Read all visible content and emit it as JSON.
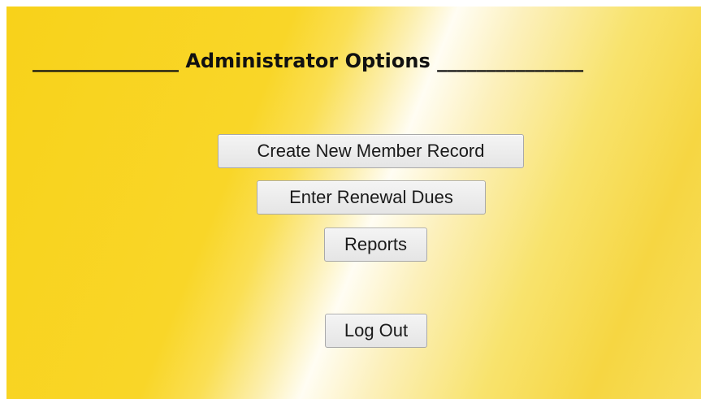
{
  "page": {
    "heading": "_______________ Administrator Options _______________"
  },
  "actions": {
    "create_new_member_record": "Create New Member Record",
    "enter_renewal_dues": "Enter Renewal Dues",
    "reports": "Reports",
    "log_out": "Log Out"
  },
  "colors": {
    "background_gold": "#f8d21a",
    "background_highlight": "#fffdf3",
    "button_face": "#e5e5e5",
    "button_border": "#a9a9a9",
    "text": "#111111"
  }
}
